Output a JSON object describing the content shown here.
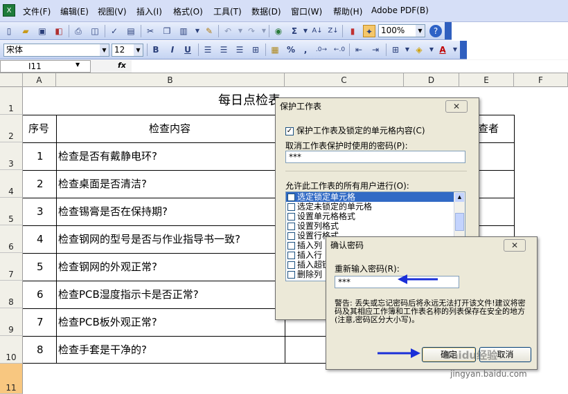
{
  "menubar": {
    "app_icon": "excel-icon",
    "items": [
      "文件(F)",
      "编辑(E)",
      "视图(V)",
      "插入(I)",
      "格式(O)",
      "工具(T)",
      "数据(D)",
      "窗口(W)",
      "帮助(H)",
      "Adobe PDF(B)"
    ]
  },
  "toolbar1": {
    "zoom": "100%",
    "icons": [
      "new-icon",
      "open-icon",
      "save-icon",
      "permission-icon",
      "print-icon",
      "print-preview-icon",
      "spelling-icon",
      "research-icon",
      "cut-icon",
      "copy-icon",
      "paste-icon",
      "format-painter-icon",
      "undo-icon",
      "redo-icon",
      "hyperlink-icon",
      "autosum-icon",
      "sort-ascending-icon",
      "sort-descending-icon",
      "chart-wizard-icon",
      "drawing-icon",
      "help-icon"
    ],
    "sum_glyph": "Σ"
  },
  "toolbar2": {
    "font": "宋体",
    "size": "12",
    "bold": "B",
    "italic": "I",
    "underline": "U",
    "percent": "%",
    "comma": ","
  },
  "formula_bar": {
    "name_box": "I11",
    "fx": "fx",
    "value": ""
  },
  "columns": [
    "A",
    "B",
    "C",
    "D",
    "E",
    "F"
  ],
  "rows": [
    "1",
    "2",
    "3",
    "4",
    "5",
    "6",
    "7",
    "8",
    "9",
    "10",
    "11"
  ],
  "sheet": {
    "title": "每日点检表",
    "header_seq": "序号",
    "header_content": "检查内容",
    "header_checker": "查者",
    "items": [
      {
        "no": "1",
        "text": "检查是否有戴静电环?"
      },
      {
        "no": "2",
        "text": "检查桌面是否清洁?"
      },
      {
        "no": "3",
        "text": "检查锡膏是否在保持期?"
      },
      {
        "no": "4",
        "text": "检查钢网的型号是否与作业指导书一致?"
      },
      {
        "no": "5",
        "text": "检查钢网的外观正常?"
      },
      {
        "no": "6",
        "text": "检查PCB湿度指示卡是否正常?"
      },
      {
        "no": "7",
        "text": "检查PCB板外观正常?"
      },
      {
        "no": "8",
        "text": "检查手套是干净的?"
      }
    ]
  },
  "protect_dialog": {
    "title": "保护工作表",
    "close": "✕",
    "protect_checkbox": "保护工作表及锁定的单元格内容(C)",
    "password_label": "取消工作表保护时使用的密码(P):",
    "password_value": "***",
    "allow_label": "允许此工作表的所有用户进行(O):",
    "options": [
      "选定锁定单元格",
      "选定未锁定的单元格",
      "设置单元格格式",
      "设置列格式",
      "设置行格式",
      "插入列",
      "插入行",
      "插入超链接",
      "删除列"
    ]
  },
  "confirm_dialog": {
    "title": "确认密码",
    "close": "✕",
    "reenter_label": "重新输入密码(R):",
    "password_value": "***",
    "warning": "警告: 丢失或忘记密码后将永远无法打开该文件!建议将密码及其相应工作簿和工作表名称的列表保存在安全的地方(注意,密码区分大小写)。",
    "ok_label": "确定",
    "cancel_label": "取消"
  },
  "watermark": {
    "brand": "Baidu经验",
    "url": "jingyan.baidu.com"
  },
  "colors": {
    "annotation_arrow": "#1a2fd8",
    "selection": "#316ac5"
  }
}
